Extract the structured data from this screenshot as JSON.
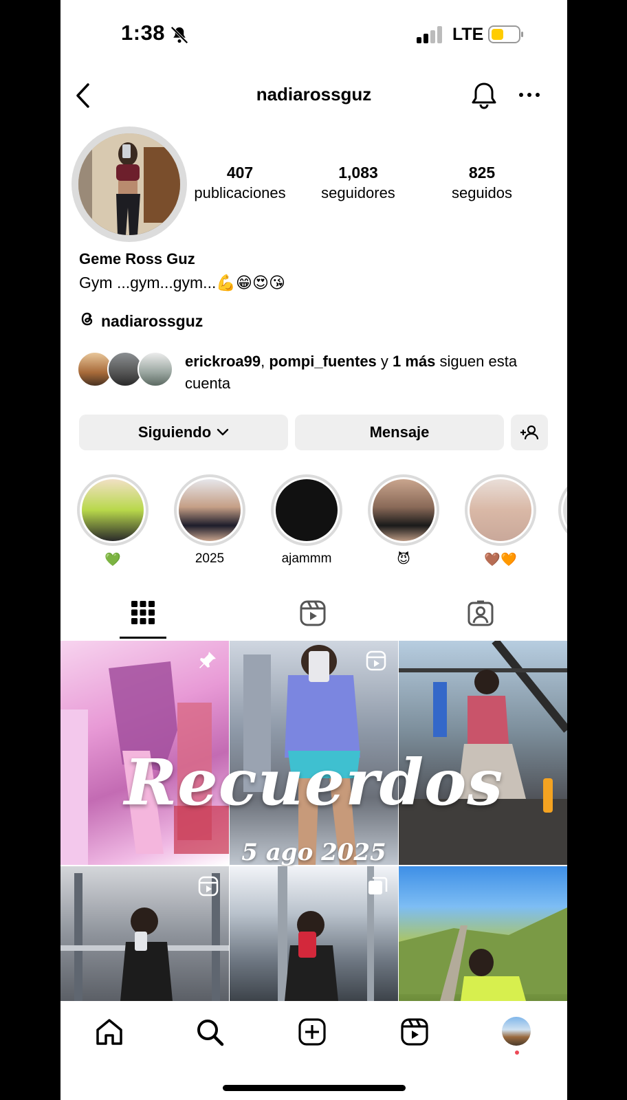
{
  "status": {
    "time": "1:38",
    "network": "LTE"
  },
  "header": {
    "username": "nadiarossguz"
  },
  "profile": {
    "stats": [
      {
        "value": "407",
        "label": "publicaciones"
      },
      {
        "value": "1,083",
        "label": "seguidores"
      },
      {
        "value": "825",
        "label": "seguidos"
      }
    ],
    "name": "Geme Ross Guz",
    "bio": "Gym ...gym...gym...💪😁😍😘",
    "threads_handle": "nadiarossguz",
    "mutual": {
      "user1": "erickroa99",
      "sep1": ", ",
      "user2": "pompi_fuentes",
      "sep2": " y ",
      "more": "1 más",
      "tail": " siguen esta cuenta"
    }
  },
  "buttons": {
    "following": "Siguiendo",
    "message": "Mensaje"
  },
  "highlights": [
    {
      "label": "💚"
    },
    {
      "label": "2025"
    },
    {
      "label": "ajammm"
    },
    {
      "label": "😈"
    },
    {
      "label": "🤎🧡"
    }
  ],
  "overlay": {
    "title": "Recuerdos",
    "date": "5 ago 2025"
  },
  "colors": {
    "notification_dot": "#ed4956",
    "story_ring": "#dbdbdb",
    "button_bg": "#efefef"
  }
}
